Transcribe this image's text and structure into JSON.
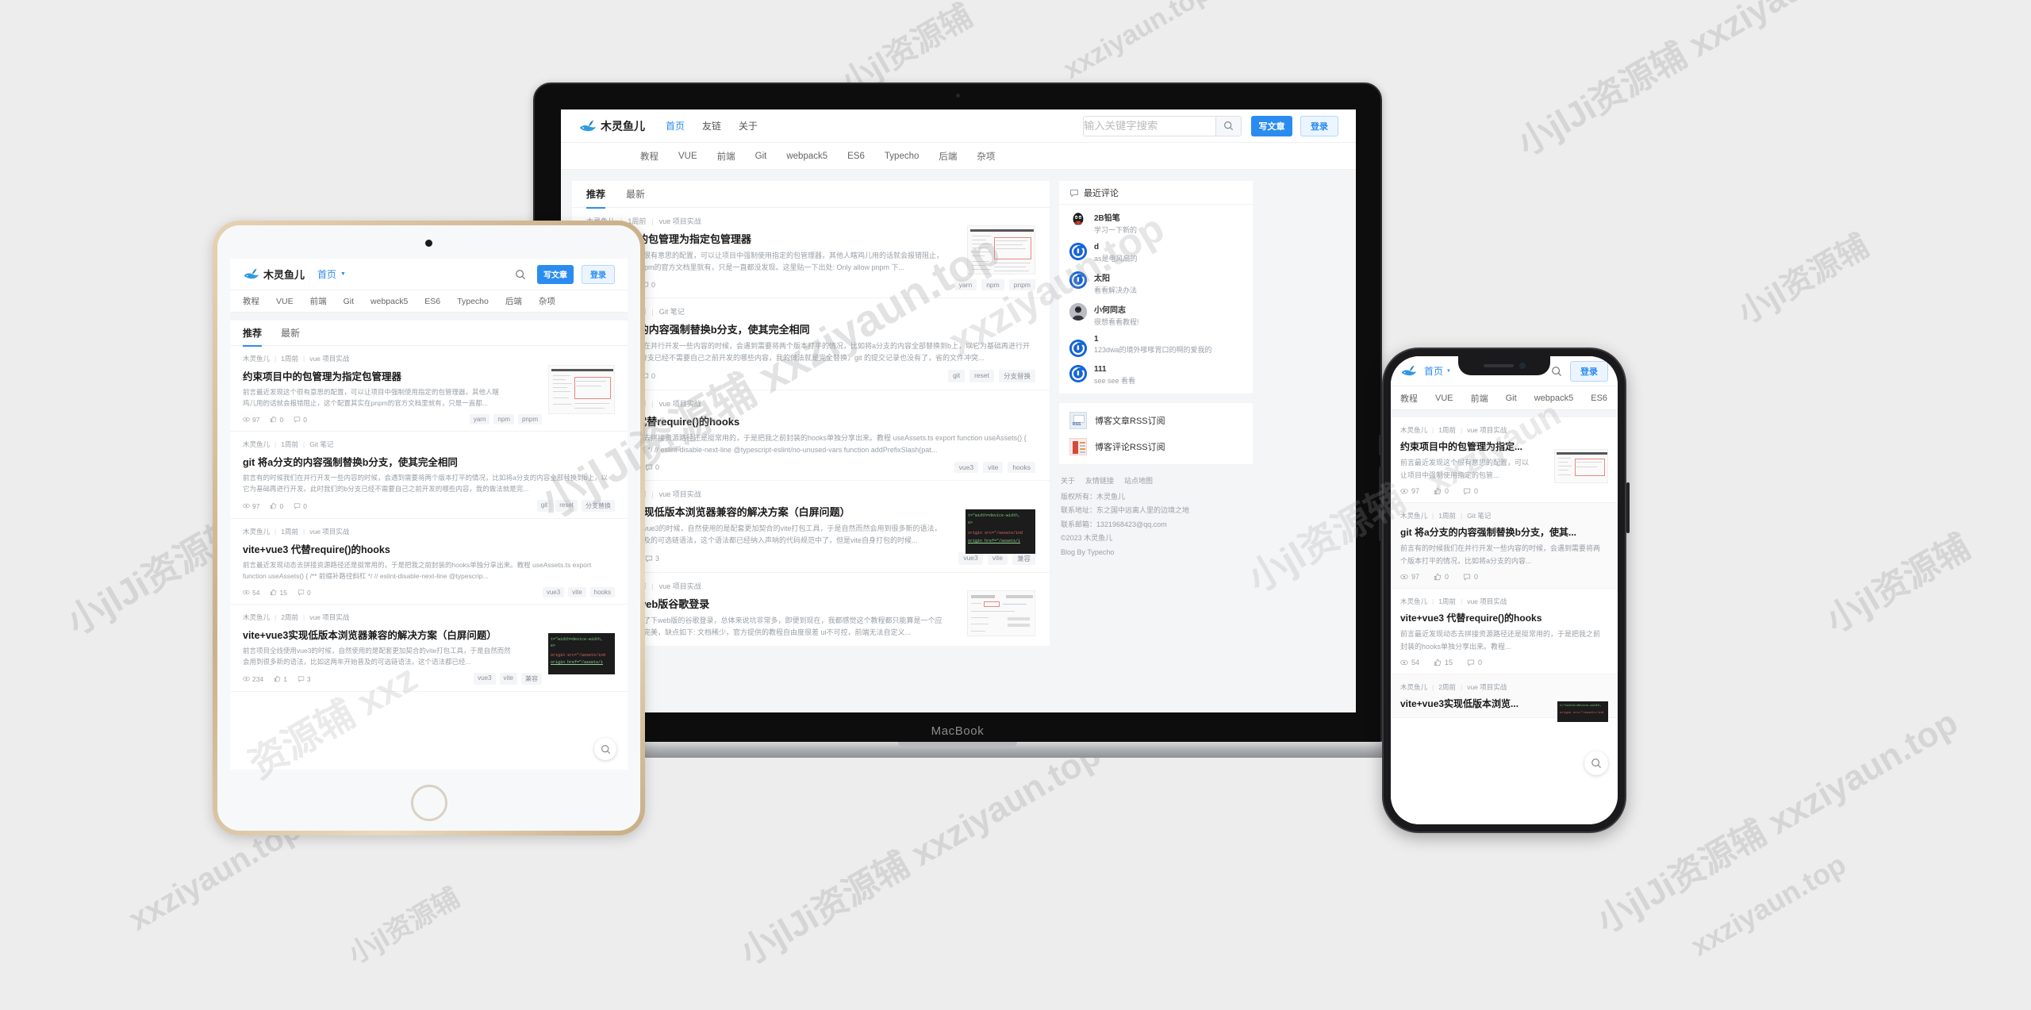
{
  "brand": {
    "name": "木灵鱼儿",
    "logo_icon": "whale-icon"
  },
  "nav": {
    "items": [
      {
        "label": "首页",
        "active": true
      },
      {
        "label": "友链",
        "active": false
      },
      {
        "label": "关于",
        "active": false
      }
    ],
    "mobile_current": "首页"
  },
  "search": {
    "placeholder": "输入关键字搜索",
    "value": "",
    "icon": "search-icon"
  },
  "actions": {
    "write": "写文章",
    "login": "登录"
  },
  "categories": [
    "教程",
    "VUE",
    "前端",
    "Git",
    "webpack5",
    "ES6",
    "Typecho",
    "后端",
    "杂项"
  ],
  "tabs": [
    {
      "label": "推荐",
      "active": true
    },
    {
      "label": "最新",
      "active": false
    }
  ],
  "posts": [
    {
      "author": "木灵鱼儿",
      "time": "1周前",
      "category": "vue 项目实战",
      "title": "约束项目中的包管理为指定包管理器",
      "title_short": "约束项目中的包管理为指定...",
      "excerpt": "前言最近发现这个很有意思的配置，可以让项目中强制使用指定的包管理器，其他人瞎鸡儿用的话就会报错阻止，这个配置其实在pnpm的官方文档里就有，只是一直都没发现。这里贴一下出处: Only allow pnpm 下...",
      "excerpt_md": "前言最近发现这个很有意思的配置，可以让项目中强制使用指定的包管理器，其他人瞎鸡儿用的话就会报错阻止，这个配置其实在pnpm的官方文档里就有，只是一直都...",
      "excerpt_sm": "前言最近发现这个很有意思的配置，可以让项目中强制使用指定的包管...",
      "views": "97",
      "likes": "0",
      "comments": "0",
      "tags": [
        "yarn",
        "npm",
        "pnpm"
      ],
      "thumb": "doc"
    },
    {
      "author": "木灵鱼儿",
      "time": "1周前",
      "category": "Git 笔记",
      "title": "git 将a分支的内容强制替换b分支，使其完全相同",
      "title_short": "git 将a分支的内容强制替换b分支，使其...",
      "excerpt": "前言有的时候我们在并行开发一些内容的时候，会遇到需要将两个版本打平的情况，比如将a分支的内容全部替换到b上，以它为基础再进行开发。此时我们的b分支已经不需要自己之前开发的哪些内容，我的做法就是完全替换，git 的提交记录也没有了，省的文件冲突...",
      "excerpt_md": "前言有的时候我们在并行开发一些内容的时候，会遇到需要将两个版本打平的情况，比如将a分支的内容全部替换到b上，以它为基础再进行开发。此时我们的b分支已经不需要自己之前开发的哪些内容，我的做法就是完...",
      "excerpt_sm": "前言有的时候我们在并行开发一些内容的时候，会遇到需要将两个版本打平的情况，比如将a分支的内容...",
      "views": "97",
      "likes": "0",
      "comments": "0",
      "tags": [
        "git",
        "reset",
        "分支替换"
      ],
      "thumb": "none"
    },
    {
      "author": "木灵鱼儿",
      "time": "1周前",
      "category": "vue 项目实战",
      "title": "vite+vue3 代替require()的hooks",
      "title_short": "vite+vue3 代替require()的hooks",
      "excerpt": "前言最近发现动态去拼接资源路径还是挺常用的，于是把我之前封装的hooks单独分享出来。教程 useAssets.ts export function useAssets() { /** 前缀补路径斜杠 */ // eslint-disable-next-line @typescript-eslint/no-unused-vars function addPrefixSlash(pat...",
      "excerpt_md": "前言最近发现动态去拼接资源路径还是挺常用的，于是把我之前封装的hooks单独分享出来。教程 useAssets.ts export function useAssets() { /** 前缀补路径斜杠 */ // eslint-disable-next-line @typescrip...",
      "excerpt_sm": "前言最近发现动态去拼接资源路径还是挺常用的，于是把我之前封装的hooks单独分享出来。教程...",
      "views": "54",
      "likes": "15",
      "comments": "0",
      "tags": [
        "vue3",
        "vite",
        "hooks"
      ],
      "thumb": "none"
    },
    {
      "author": "木灵鱼儿",
      "time": "2周前",
      "category": "vue 项目实战",
      "title": "vite+vue3实现低版本浏览器兼容的解决方案（白屏问题）",
      "title_short": "vite+vue3实现低版本浏览...",
      "excerpt": "前言项目全线使用vue3的时候，自然使用的是配套更加契合的vite打包工具，于是自然而然会用到很多新的语法，比如这两年开始普及的可选链语法，这个语法都已经纳入声呐的代码规范中了，但是vite自身打包的时候...",
      "excerpt_md": "前言项目全线使用vue3的时候，自然使用的是配套更加契合的vite打包工具，于是自然而然会用到很多新的语法，比如这两年开始普及的可选链语法，这个语法都已经...",
      "excerpt_sm": "前言项目全线使用vue3的时候，自然使用的是配套更加契合的vite打包工具...",
      "views": "234",
      "likes": "1",
      "comments": "3",
      "tags": [
        "vue3",
        "vite",
        "兼容"
      ],
      "thumb": "code"
    },
    {
      "author": "木灵鱼儿",
      "time": "2周前",
      "category": "vue 项目实战",
      "title": "简单的对接web版谷歌登录",
      "title_short": "简单的对接web版谷歌登录",
      "excerpt": "前言这段时间对接了下web版的谷歌登录，总体来说坑非常多，即便到现在，我都感觉这个教程都只能算是一个应急处理方案，并不完美，缺点如下: 文档稀少，官方提供的教程自由度很差 ui不可控，前端无法自定义...",
      "excerpt_md": "前言这段时间对接了下web版的谷歌登录，总体来说坑非常多，即便到现在，我都感觉这个教程都只能算是一个应急处理方案...",
      "excerpt_sm": "前言这段时间对接了下web版的谷歌登录...",
      "views": "",
      "likes": "",
      "comments": "",
      "tags": [],
      "thumb": "form"
    }
  ],
  "code_thumb_lines": [
    "t=\"width=device-width,",
    "e>",
    "origin src=\"/assets/ind",
    "origin href=\"/assets/i"
  ],
  "sidebar": {
    "comments_title": "最近评论",
    "comments_icon": "comment-bubble-icon",
    "comments": [
      {
        "name": "2B铅笔",
        "text": "学习一下新的",
        "avatar": "qq-penguin"
      },
      {
        "name": "d",
        "text": "as是电风扇的",
        "avatar": "blue-c"
      },
      {
        "name": "太阳",
        "text": "看看解决办法",
        "avatar": "blue-c"
      },
      {
        "name": "小何同志",
        "text": "很想看看教程!",
        "avatar": "photo"
      },
      {
        "name": "1",
        "text": "123dwa的境外嗲嗲胃口的啊的爱我的",
        "avatar": "blue-c"
      },
      {
        "name": "111",
        "text": "see see 看看",
        "avatar": "blue-c"
      }
    ],
    "rss": [
      {
        "label": "博客文章RSS订阅",
        "icon": "rss-article-icon"
      },
      {
        "label": "博客评论RSS订阅",
        "icon": "rss-comment-icon"
      }
    ]
  },
  "footer": {
    "links": [
      "关于",
      "友情链接",
      "站点地图"
    ],
    "lines": [
      "版权所有：木灵鱼儿",
      "联系地址：东之国中远离人里的边境之地",
      "联系邮箱：1321968423@qq.com",
      "©2023 木灵鱼儿",
      "Blog By Typecho"
    ]
  },
  "devices": {
    "laptop_label": "MacBook"
  },
  "watermarks": [
    "小JvJi资源辅 xxziyaun.top",
    "xxziyaun.top",
    "小JvJi资源辅"
  ],
  "colors": {
    "accent": "#2b8cf0",
    "bg": "#ededed",
    "panel": "#ffffff",
    "muted": "#9aa0a6"
  }
}
